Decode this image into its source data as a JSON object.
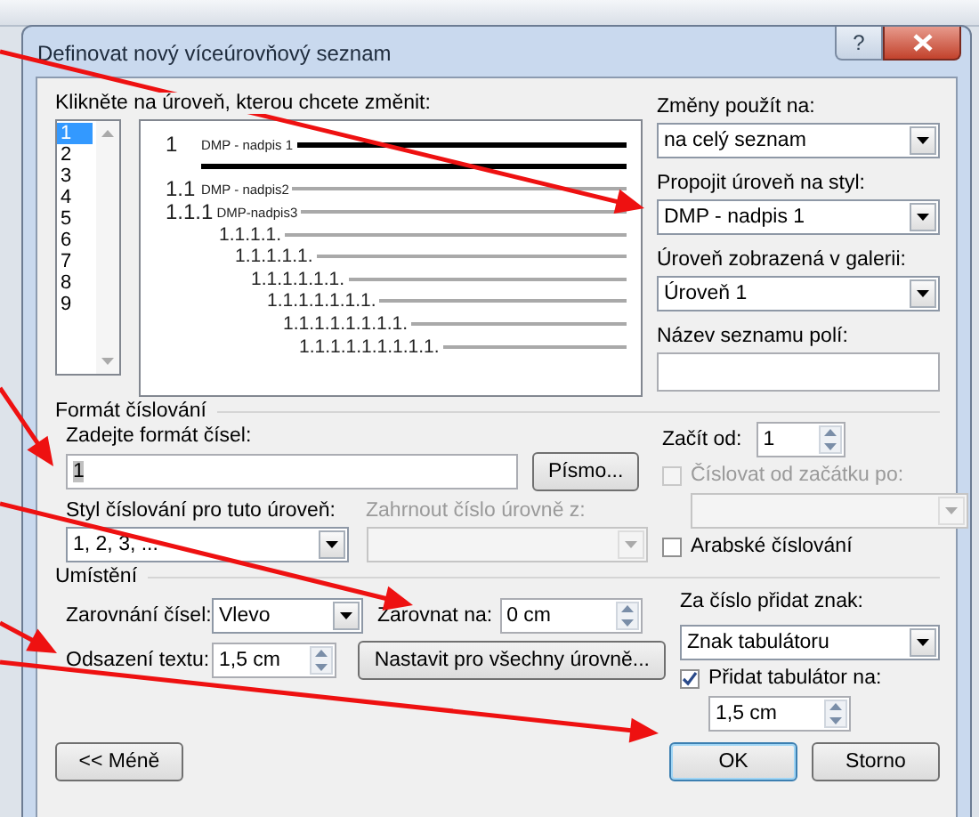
{
  "window": {
    "title": "Definovat nový víceúrovňový seznam",
    "help_button": "?"
  },
  "levels": {
    "label": "Klikněte na úroveň, kterou chcete změnit:",
    "items": [
      {
        "label": "1",
        "selected": true
      },
      {
        "label": "2",
        "selected": false
      },
      {
        "label": "3",
        "selected": false
      },
      {
        "label": "4",
        "selected": false
      },
      {
        "label": "5",
        "selected": false
      },
      {
        "label": "6",
        "selected": false
      },
      {
        "label": "7",
        "selected": false
      },
      {
        "label": "8",
        "selected": false
      },
      {
        "label": "9",
        "selected": false
      }
    ]
  },
  "preview": {
    "levels": [
      {
        "number": "1",
        "text": "DMP - nadpis 1",
        "children": [
          {
            "number": "1.1",
            "text": "DMP - nadpis2",
            "children": [
              {
                "number": "1.1.1",
                "text": "DMP-nadpis3",
                "children": [
                  {
                    "number": "1.1.1.1.",
                    "children": [
                      {
                        "number": "1.1.1.1.1.",
                        "children": [
                          {
                            "number": "1.1.1.1.1.1.",
                            "children": [
                              {
                                "number": "1.1.1.1.1.1.1.",
                                "children": [
                                  {
                                    "number": "1.1.1.1.1.1.1.1.",
                                    "children": [
                                      {
                                        "number": "1.1.1.1.1.1.1.1.1."
                                      }
                                    ]
                                  }
                                ]
                              }
                            ]
                          }
                        ]
                      }
                    ]
                  }
                ]
              }
            ]
          }
        ]
      }
    ]
  },
  "apply_to": {
    "label": "Změny použít na:",
    "value": "na celý seznam"
  },
  "link_style": {
    "label": "Propojit úroveň na styl:",
    "value": "DMP - nadpis 1"
  },
  "gallery_level": {
    "label": "Úroveň zobrazená v galerii:",
    "value": "Úroveň 1"
  },
  "field_list_name": {
    "label": "Název seznamu polí:"
  },
  "number_format": {
    "title": "Formát číslování",
    "format": {
      "label": "Zadejte formát čísel:",
      "value": "1"
    },
    "font_button": "Písmo...",
    "style": {
      "label": "Styl číslování pro tuto úroveň:",
      "value": "1, 2, 3, ..."
    },
    "include_level": {
      "label": "Zahrnout číslo úrovně z:",
      "disabled": true
    },
    "start_at": {
      "label": "Začít od:",
      "value": "1"
    },
    "restart": {
      "label": "Číslovat od začátku po:",
      "checked": false,
      "disabled": true
    },
    "restart_select": {
      "disabled": true
    },
    "legal": {
      "label": "Arabské číslování",
      "checked": false
    }
  },
  "position": {
    "title": "Umístění",
    "alignment": {
      "label": "Zarovnání čísel:",
      "value": "Vlevo"
    },
    "aligned_at": {
      "label": "Zarovnat na:",
      "value": "0 cm"
    },
    "indent": {
      "label": "Odsazení textu:",
      "value": "1,5 cm"
    },
    "set_all_button": "Nastavit pro všechny úrovně...",
    "follow": {
      "label": "Za číslo přidat znak:",
      "value": "Znak tabulátoru"
    },
    "tab_stop": {
      "label": "Přidat tabulátor na:",
      "checked": true,
      "value": "1,5 cm"
    }
  },
  "buttons": [
    {
      "label": "<< Méně",
      "default": false
    },
    {
      "label": "OK",
      "default": true
    },
    {
      "label": "Storno",
      "default": false
    }
  ]
}
